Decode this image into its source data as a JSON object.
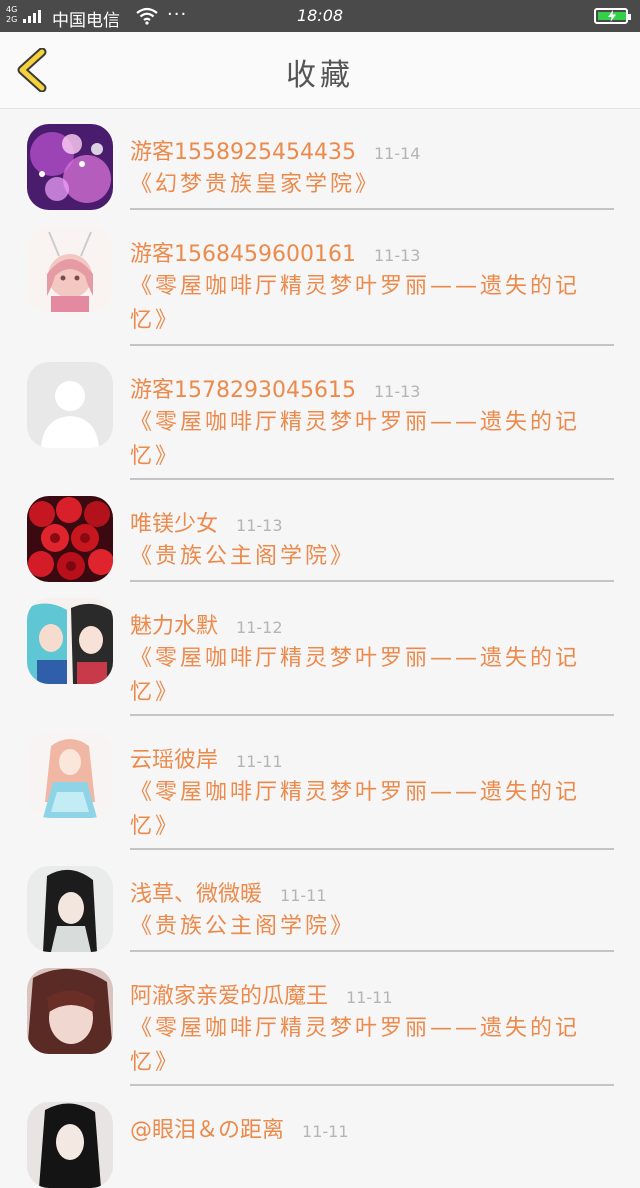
{
  "status_bar": {
    "network": "4G",
    "network2": "2G",
    "carrier": "中国电信",
    "more": "···",
    "time": "18:08"
  },
  "header": {
    "title": "收藏"
  },
  "favorites": [
    {
      "user": "游客1558925454435",
      "date": "11-14",
      "book": "《幻梦贵族皇家学院》"
    },
    {
      "user": "游客1568459600161",
      "date": "11-13",
      "book": "《零屋咖啡厅精灵梦叶罗丽——遗失的记忆》"
    },
    {
      "user": "游客1578293045615",
      "date": "11-13",
      "book": "《零屋咖啡厅精灵梦叶罗丽——遗失的记忆》"
    },
    {
      "user": "唯镁少女",
      "date": "11-13",
      "book": "《贵族公主阁学院》"
    },
    {
      "user": "魅力水默",
      "date": "11-12",
      "book": "《零屋咖啡厅精灵梦叶罗丽——遗失的记忆》"
    },
    {
      "user": "云瑶彼岸",
      "date": "11-11",
      "book": "《零屋咖啡厅精灵梦叶罗丽——遗失的记忆》"
    },
    {
      "user": "浅草、微微暖",
      "date": "11-11",
      "book": "《贵族公主阁学院》"
    },
    {
      "user": "阿澈家亲爱的瓜魔王",
      "date": "11-11",
      "book": "《零屋咖啡厅精灵梦叶罗丽——遗失的记忆》"
    },
    {
      "user": "@眼泪＆の距离",
      "date": "11-11",
      "book": ""
    }
  ],
  "colors": {
    "accent": "#ec8a4c",
    "date": "#b5b5b5",
    "back_arrow": "#f5d23c",
    "status_bar": "#4a4a4a",
    "battery": "#33d14a"
  }
}
